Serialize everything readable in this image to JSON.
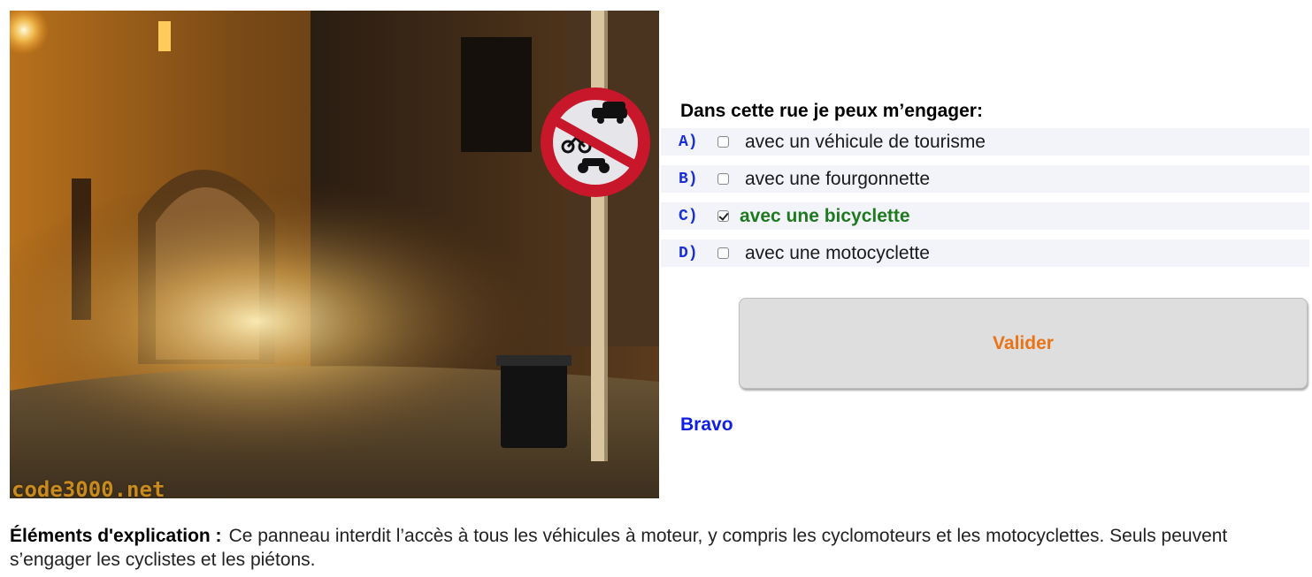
{
  "image": {
    "watermark": "code3000.net",
    "sign": "no-motor-vehicles-sign-icon"
  },
  "quiz": {
    "question": "Dans cette rue je peux m’engager:",
    "answers": [
      {
        "letter": "A)",
        "label": "avec un véhicule de tourisme",
        "checked": false,
        "correct": false
      },
      {
        "letter": "B)",
        "label": "avec une fourgonnette",
        "checked": false,
        "correct": false
      },
      {
        "letter": "C)",
        "label": "avec une bicyclette",
        "checked": true,
        "correct": true
      },
      {
        "letter": "D)",
        "label": "avec une motocyclette",
        "checked": false,
        "correct": false
      }
    ],
    "validate_label": "Valider",
    "feedback": "Bravo"
  },
  "explanation": {
    "heading": "Éléments d'explication :",
    "text": "Ce panneau interdit l’accès à tous les véhicules à moteur, y compris les cyclomoteurs et les motocyclettes. Seuls peuvent s’engager les cyclistes et les piétons."
  },
  "colors": {
    "letter": "#1b2fd6",
    "correct": "#1f7a1f",
    "validate_text": "#ea7318",
    "feedback": "#1020e0",
    "row_bg": "#f2f4fa"
  }
}
